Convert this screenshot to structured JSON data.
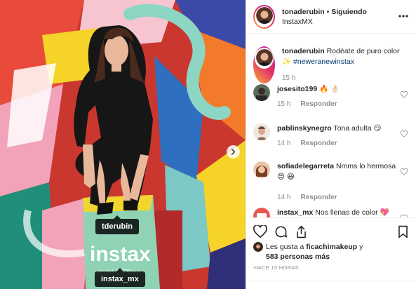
{
  "tags": {
    "person": "tderubin",
    "brand": "instax_mx"
  },
  "header": {
    "username": "tonaderubin",
    "separator": " • ",
    "follow_status": "Siguiendo",
    "subtitle": "InstaxMX"
  },
  "caption": {
    "username": "tonaderubin",
    "text": "Rodéate de puro color",
    "sparkle": "✨",
    "hashtag": "#neweranewinstax",
    "time": "15 h"
  },
  "comments": [
    {
      "username": "josesito199",
      "text": "🔥 👌🏻",
      "time": "15 h",
      "reply": "Responder"
    },
    {
      "username": "pablinskynegro",
      "text": "Tona adulta 😏",
      "time": "14 h",
      "reply": "Responder"
    },
    {
      "username": "sofiadelegarreta",
      "text": "Nmms lo hermosa 😍 😆",
      "time": "14 h",
      "reply": "Responder"
    },
    {
      "username": "instax_mx",
      "text": "Nos llenas de color 💖"
    }
  ],
  "likes": {
    "prefix": "Les gusta a ",
    "user": "ficachimakeup",
    "joiner": " y",
    "others": "583 personas más"
  },
  "timestamp": "HACE 15 HORAS",
  "icons": [
    "heart-icon",
    "comment-icon",
    "share-icon",
    "bookmark-icon",
    "more-icon",
    "chevron-right-icon"
  ],
  "colors": {
    "link": "#00376b",
    "muted": "#8e8e8e",
    "avatar_ring": "#e1306c"
  }
}
